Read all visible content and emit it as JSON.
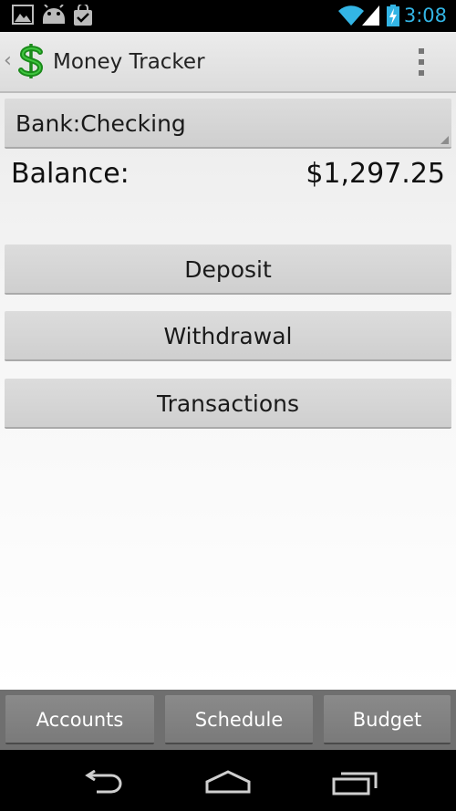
{
  "status_bar": {
    "time": "3:08",
    "icons": [
      "gallery-icon",
      "android-icon",
      "shopping-bag-check-icon",
      "wifi-icon",
      "signal-icon",
      "battery-charging-icon"
    ],
    "accent_color": "#33b5e5"
  },
  "action_bar": {
    "title": "Money Tracker",
    "logo": "dollar-sign-icon",
    "logo_color": "#1a8a1a",
    "overflow": "overflow-menu-icon"
  },
  "account": {
    "selected": "Bank:Checking"
  },
  "balance": {
    "label": "Balance:",
    "value": "$1,297.25"
  },
  "actions": {
    "deposit": "Deposit",
    "withdrawal": "Withdrawal",
    "transactions": "Transactions"
  },
  "bottom_tabs": {
    "accounts": "Accounts",
    "schedule": "Schedule",
    "budget": "Budget"
  },
  "nav_bar": {
    "icons": [
      "back-icon",
      "home-icon",
      "recent-apps-icon"
    ]
  }
}
